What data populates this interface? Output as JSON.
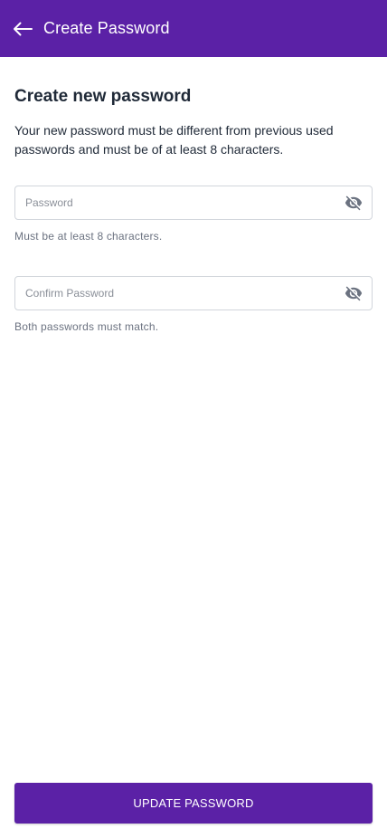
{
  "colors": {
    "primary": "#5b21a6",
    "on_primary": "#ffffff",
    "heading_text": "#1f2937",
    "helper_text": "#6b7280",
    "placeholder_text": "#8a8f98",
    "field_border": "#d1d5db"
  },
  "app_bar": {
    "title": "Create Password",
    "back_icon": "arrow-left-icon"
  },
  "main": {
    "heading": "Create new password",
    "description": "Your new password must be different from previous used passwords and must be of at least 8 characters."
  },
  "form": {
    "password": {
      "placeholder": "Password",
      "value": "",
      "visibility_icon": "eye-off-icon",
      "helper": "Must be at least 8 characters."
    },
    "confirm_password": {
      "placeholder": "Confirm Password",
      "value": "",
      "visibility_icon": "eye-off-icon",
      "helper": "Both passwords must match."
    }
  },
  "actions": {
    "submit_label": "UPDATE PASSWORD"
  }
}
